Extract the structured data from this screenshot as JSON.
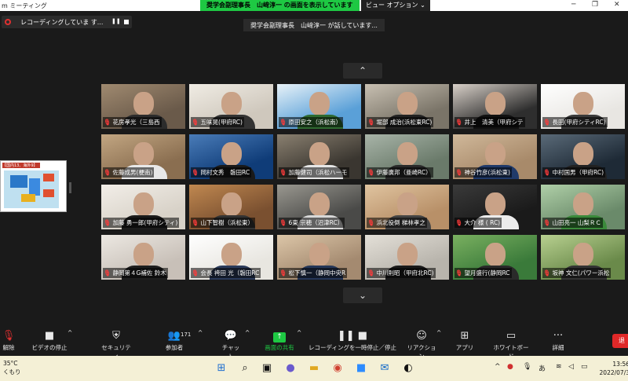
{
  "titlebar": {
    "app_name": "m ミーティング",
    "share_banner": "奨学会副理事長　山﨑淳一 の画面を表示しています",
    "view_options": "ビュー オプション ⌄",
    "minimize": "─",
    "restore": "❐",
    "close": "✕"
  },
  "recording": {
    "label": "レコーディングしていま す...",
    "pause": "❚❚"
  },
  "speaking_banner": "奨学会副理事長　山﨑淳一 が話しています...",
  "nav": {
    "up": "⌃",
    "down": "⌄"
  },
  "shared_thumbnail": {
    "header": "【国内13、海外9】"
  },
  "participants": [
    {
      "name": "花房孝光（三島西",
      "bg": "#6a5a4a",
      "bg2": "#a08a70",
      "shirt": "#2c2c2c"
    },
    {
      "name": "五味晃(甲府RC)",
      "bg": "#cfc8bd",
      "bg2": "#f0ece4",
      "shirt": "#333"
    },
    {
      "name": "原田安之（浜松南）",
      "bg": "#5aa0d8",
      "bg2": "#e8f2f8",
      "shirt": "#2f6a30"
    },
    {
      "name": "堀部 成治(浜松東RC)",
      "bg": "#7a7468",
      "bg2": "#c8c0b2",
      "shirt": "#222"
    },
    {
      "name": "井上　清美（甲府シテ",
      "bg": "#2e2e2e",
      "bg2": "#d8d0c8",
      "shirt": "#111"
    },
    {
      "name": "長田(甲府シティRC)",
      "bg": "#e8e6e2",
      "bg2": "#ffffff",
      "shirt": "#3a3a3a"
    },
    {
      "name": "佐藤成男(梗南)",
      "bg": "#8a6e50",
      "bg2": "#c2a682",
      "shirt": "#e8e8e8"
    },
    {
      "name": "岡村文秀　磐田RC",
      "bg": "#0f3c78",
      "bg2": "#4a7cb8",
      "shirt": "#1a1a1a"
    },
    {
      "name": "加藤健司（浜松ハーモ",
      "bg": "#3a3630",
      "bg2": "#8a8070",
      "shirt": "#e6e6e6"
    },
    {
      "name": "伊藤廣邦（亜崎RC）",
      "bg": "#6a7a6a",
      "bg2": "#a8b4a8",
      "shirt": "#2a2a2a"
    },
    {
      "name": "神谷竹彦(浜松東)",
      "bg": "#a88a6a",
      "bg2": "#d0b89a",
      "shirt": "#203a6a"
    },
    {
      "name": "中村国男（甲府RC)",
      "bg": "#1e2a36",
      "bg2": "#5a6a78",
      "shirt": "#222"
    },
    {
      "name": "加藤 勇一郎(甲府シティ)",
      "bg": "#d8d2c8",
      "bg2": "#f2eee8",
      "shirt": "#1c1c1c"
    },
    {
      "name": "山下智樹（浜松東）",
      "bg": "#7a5030",
      "bg2": "#c08850",
      "shirt": "#333"
    },
    {
      "name": "6東 宗穂（沼津RC）",
      "bg": "#4a4a48",
      "bg2": "#9a9890",
      "shirt": "#d8d8d8"
    },
    {
      "name": "浜北役倒 梯林孝之",
      "bg": "#b89068",
      "bg2": "#e0c4a0",
      "shirt": "#444"
    },
    {
      "name": "大介 様 (      RC)",
      "bg": "#1a1a1a",
      "bg2": "#3a3a3a",
      "shirt": "#ececec"
    },
    {
      "name": "山田亮一 山梨ＲＣ",
      "bg": "#6a8a6a",
      "bg2": "#b0d0a8",
      "shirt": "#3a8a3a"
    },
    {
      "name": "静岡第４G補佐 鈴木",
      "bg": "#c8c0b8",
      "bg2": "#ece8e2",
      "shirt": "#1e1e1e"
    },
    {
      "name": "会長 袴田 光（磐田RC",
      "bg": "#e8e6e0",
      "bg2": "#ffffff",
      "shirt": "#2a3a5a"
    },
    {
      "name": "松下慎一（静岡中央R",
      "bg": "#a48a70",
      "bg2": "#dcc6a8",
      "shirt": "#243658"
    },
    {
      "name": "中川則昭（甲府北RC)",
      "bg": "#b8b4ac",
      "bg2": "#e4e0d8",
      "shirt": "#1a1a1a"
    },
    {
      "name": "望月盛行(静岡RC",
      "bg": "#3a7a3a",
      "bg2": "#7ab060",
      "shirt": "#2a2a2a"
    },
    {
      "name": "坂神 文仁(パワー浜松",
      "bg": "#6a8a4a",
      "bg2": "#b8d090",
      "shirt": "#333"
    }
  ],
  "toolbar": {
    "mute": "解除",
    "video": "ビデオの停止",
    "security": "セキュリティ",
    "participants": "参加者",
    "participant_count": "171",
    "chat": "チャット",
    "share": "画面の共有",
    "pause_record": "レコーディングを一時停止／停止",
    "reactions": "リアクション",
    "apps": "アプリ",
    "whiteboard": "ホワイトボード",
    "more": "詳細",
    "end": "退"
  },
  "taskbar": {
    "temperature": "35°C",
    "weather": "くもり",
    "ime": "あ",
    "time": "13:56",
    "date": "2022/07/3"
  }
}
